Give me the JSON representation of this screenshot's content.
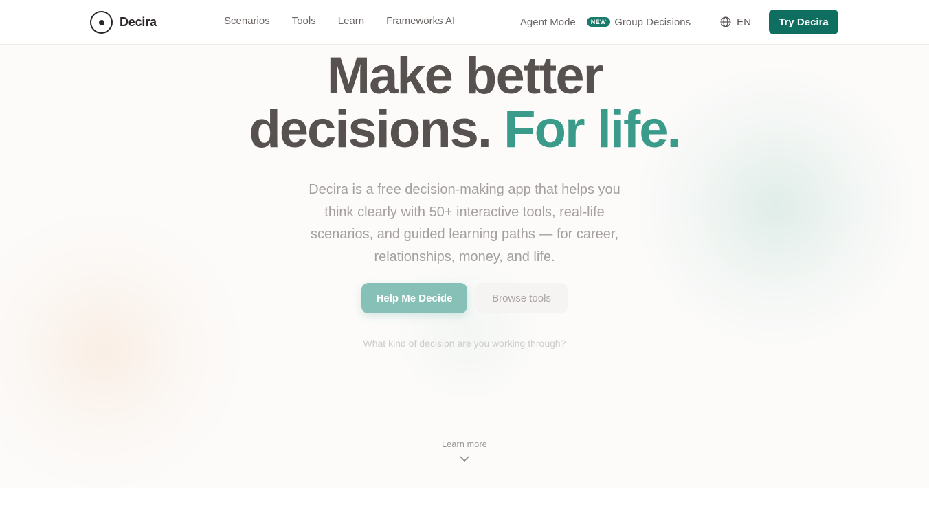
{
  "brand": {
    "name": "Decira"
  },
  "nav": {
    "links": [
      "Scenarios",
      "Tools",
      "Learn",
      "Frameworks AI"
    ],
    "agent_mode": "Agent Mode",
    "new_badge": "NEW",
    "group_decisions": "Group Decisions",
    "language": "EN",
    "try_button": "Try Decira"
  },
  "hero": {
    "headline_line1": "Make better",
    "headline_line2_plain": "decisions.",
    "headline_line2_accent": "For life.",
    "subtext": "Decira is a free decision-making app that helps you think clearly with 50+ interactive tools, real-life scenarios, and guided learning paths — for career, relationships, money, and life.",
    "primary_cta": "Help Me Decide",
    "secondary_cta": "Browse tools",
    "prompt": "What kind of decision are you working through?"
  },
  "learn_more": {
    "label": "Learn more"
  },
  "colors": {
    "accent": "#0e6e60",
    "accent_text": "#3a9b8a",
    "primary_button": "#86c0b6",
    "headline": "#575250"
  },
  "icons": {
    "logo": "circle-dot-icon",
    "language": "globe-icon",
    "scroll": "chevron-down-icon"
  }
}
